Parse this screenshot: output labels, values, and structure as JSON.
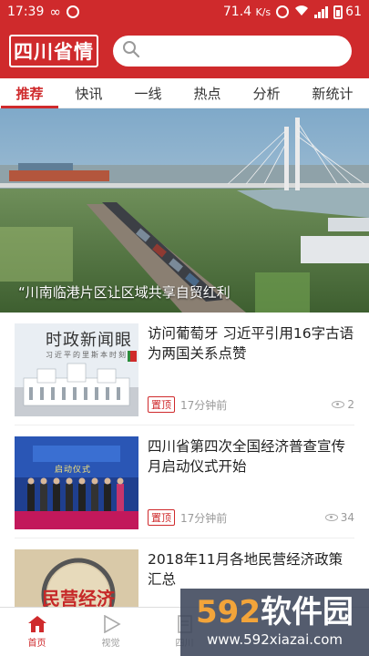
{
  "status_bar": {
    "time": "17:39",
    "speed": "71.4",
    "speed_unit": "K/s",
    "battery": "61"
  },
  "header": {
    "logo": "四川省情",
    "search_placeholder": ""
  },
  "tabs": [
    "推荐",
    "快讯",
    "一线",
    "热点",
    "分析",
    "新统计"
  ],
  "hero": {
    "caption": "“川南临港片区让区域共享自贸红利"
  },
  "news": [
    {
      "title": "访问葡萄牙 习近平引用16字古语为两国关系点赞",
      "thumb_text": "时政新闻眼",
      "thumb_sub": "习近平的里斯本时刻",
      "badge": "置顶",
      "time": "17分钟前",
      "views": "2"
    },
    {
      "title": "四川省第四次全国经济普查宣传月启动仪式开始",
      "thumb_text": "启动仪式",
      "badge": "置顶",
      "time": "17分钟前",
      "views": "34"
    },
    {
      "title": "2018年11月各地民营经济政策汇总",
      "thumb_text": "民营经济"
    }
  ],
  "bottom_nav": [
    {
      "label": "首页"
    },
    {
      "label": "视觉"
    },
    {
      "label": "四川"
    }
  ],
  "watermark": {
    "main_num": "592",
    "main_text": "软件园",
    "sub": "www.592xiazai.com"
  },
  "colors": {
    "brand": "#cf2a2c"
  }
}
